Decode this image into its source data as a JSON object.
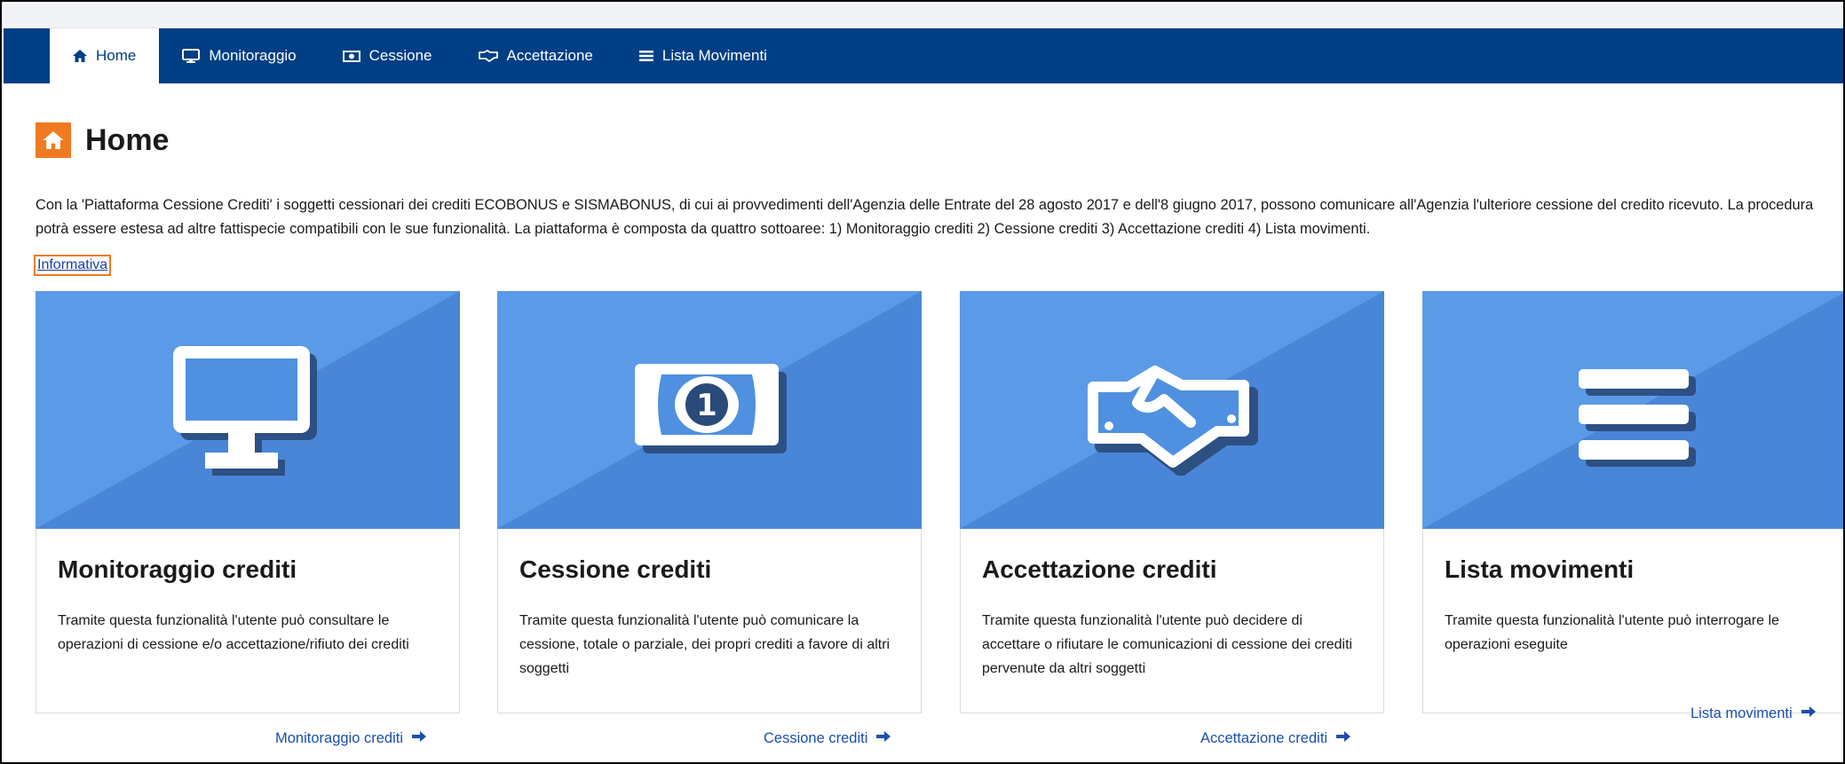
{
  "nav": {
    "items": [
      {
        "label": "Home",
        "icon": "home-icon",
        "active": true
      },
      {
        "label": "Monitoraggio",
        "icon": "monitor-icon",
        "active": false
      },
      {
        "label": "Cessione",
        "icon": "money-icon",
        "active": false
      },
      {
        "label": "Accettazione",
        "icon": "handshake-icon",
        "active": false
      },
      {
        "label": "Lista Movimenti",
        "icon": "list-icon",
        "active": false
      }
    ]
  },
  "page": {
    "title": "Home",
    "intro": "Con la 'Piattaforma Cessione Crediti' i soggetti cessionari dei crediti ECOBONUS e SISMABONUS, di cui ai provvedimenti dell'Agenzia delle Entrate del 28 agosto 2017 e dell'8 giugno 2017, possono comunicare all'Agenzia l'ulteriore cessione del credito ricevuto. La procedura potrà essere estesa ad altre fattispecie compatibili con le sue funzionalità. La piattaforma è composta da quattro sottoaree: 1) Monitoraggio crediti 2) Cessione crediti 3) Accettazione crediti 4) Lista movimenti.",
    "info_link": "Informativa"
  },
  "cards": [
    {
      "title": "Monitoraggio crediti",
      "description": "Tramite questa funzionalità l'utente può consultare le operazioni di cessione e/o accettazione/rifiuto dei crediti",
      "link": "Monitoraggio crediti",
      "icon": "monitor-icon"
    },
    {
      "title": "Cessione crediti",
      "description": "Tramite questa funzionalità l'utente può comunicare la cessione, totale o parziale, dei propri crediti a favore di altri soggetti",
      "link": "Cessione crediti",
      "icon": "money-icon"
    },
    {
      "title": "Accettazione crediti",
      "description": "Tramite questa funzionalità l'utente può decidere di accettare o rifiutare le comunicazioni di cessione dei crediti pervenute da altri soggetti",
      "link": "Accettazione crediti",
      "icon": "handshake-icon"
    },
    {
      "title": "Lista movimenti",
      "description": "Tramite questa funzionalità l'utente può interrogare le operazioni eseguite",
      "link": "Lista movimenti",
      "icon": "list-icon"
    }
  ],
  "colors": {
    "navbar": "#003f85",
    "accent": "#f07a21",
    "card_hero_light": "#5b9ae6",
    "card_hero_dark": "#4a86d8",
    "link": "#1a4fb0"
  }
}
